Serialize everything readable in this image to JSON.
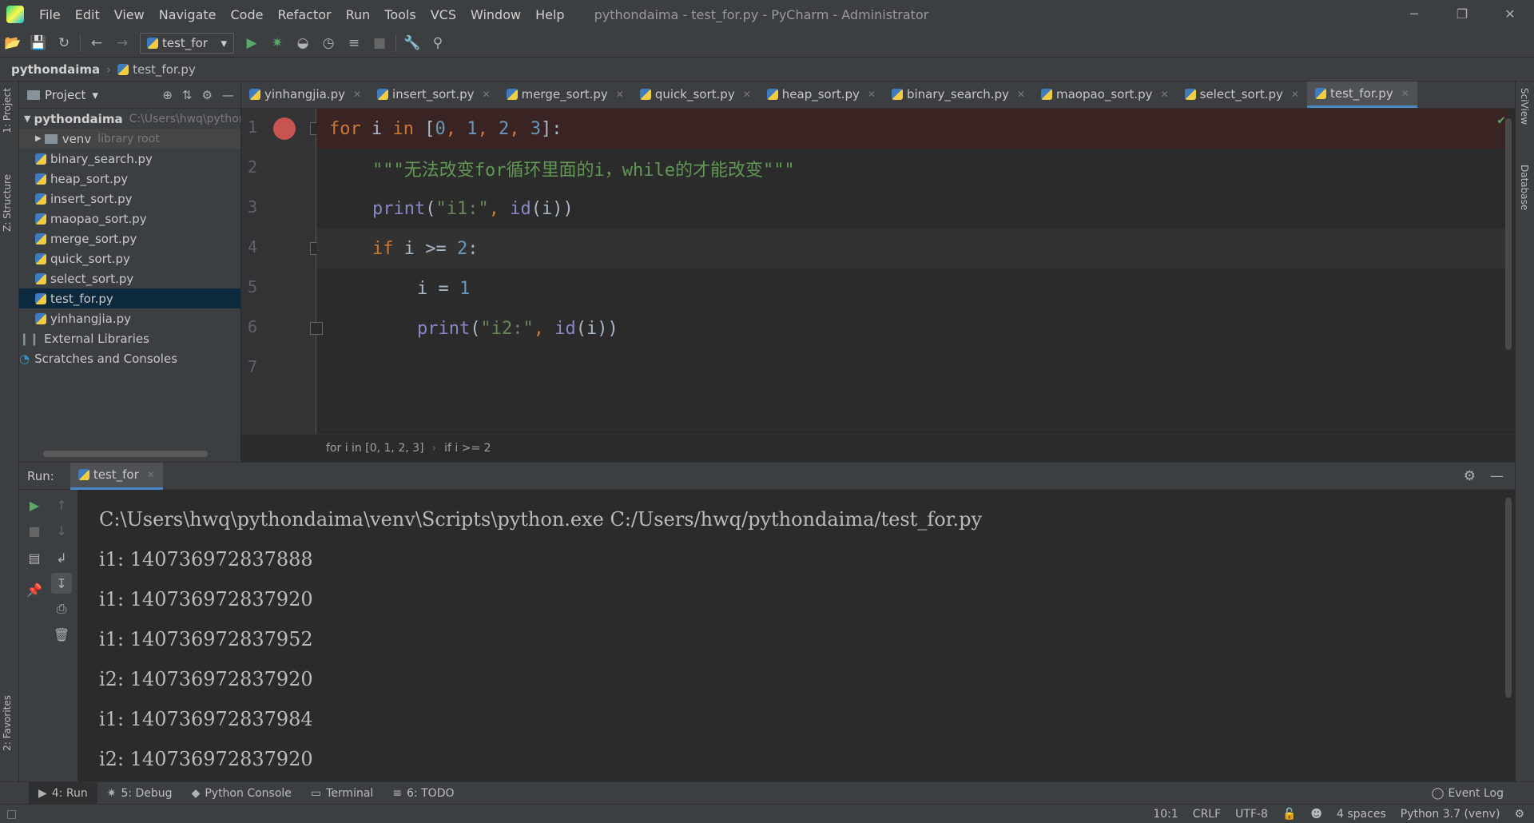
{
  "window": {
    "title": "pythondaima - test_for.py - PyCharm - Administrator",
    "minimize": "─",
    "restore": "❐",
    "close": "✕"
  },
  "menu": [
    "File",
    "Edit",
    "View",
    "Navigate",
    "Code",
    "Refactor",
    "Run",
    "Tools",
    "VCS",
    "Window",
    "Help"
  ],
  "toolbar": {
    "run_config": "test_for"
  },
  "navbar": {
    "project": "pythondaima",
    "file": "test_for.py"
  },
  "side_tabs": {
    "project": "1: Project",
    "structure": "Z: Structure",
    "favorites": "2: Favorites",
    "sciview": "SciView",
    "database": "Database"
  },
  "project_panel": {
    "header": "Project",
    "root": {
      "name": "pythondaima",
      "path": "C:\\Users\\hwq\\pythondaima"
    },
    "venv": {
      "name": "venv",
      "note": "library root"
    },
    "files": [
      "binary_search.py",
      "heap_sort.py",
      "insert_sort.py",
      "maopao_sort.py",
      "merge_sort.py",
      "quick_sort.py",
      "select_sort.py",
      "test_for.py",
      "yinhangjia.py"
    ],
    "selected": "test_for.py",
    "external": "External Libraries",
    "scratches": "Scratches and Consoles"
  },
  "editor_tabs": [
    "yinhangjia.py",
    "insert_sort.py",
    "merge_sort.py",
    "quick_sort.py",
    "heap_sort.py",
    "binary_search.py",
    "maopao_sort.py",
    "select_sort.py",
    "test_for.py"
  ],
  "active_tab": "test_for.py",
  "line_numbers": [
    "1",
    "2",
    "3",
    "4",
    "5",
    "6",
    "7"
  ],
  "code": {
    "l1": {
      "kw1": "for",
      "var": " i ",
      "kw2": "in",
      "open": " [",
      "n0": "0",
      "c1": ", ",
      "n1": "1",
      "c2": ", ",
      "n2": "2",
      "c3": ", ",
      "n3": "3",
      "close": "]:"
    },
    "l2": "\"\"\"无法改变for循环里面的i，while的才能改变\"\"\"",
    "l3": {
      "fn": "print",
      "open": "(",
      "s": "\"i1:\"",
      "comma": ", ",
      "fn2": "id",
      "rest": "(i))"
    },
    "l4": {
      "kw": "if",
      "mid": " i >= ",
      "n": "2",
      "end": ":"
    },
    "l5": {
      "var": "i = ",
      "n": "1"
    },
    "l6": {
      "fn": "print",
      "open": "(",
      "s": "\"i2:\"",
      "comma": ", ",
      "fn2": "id",
      "rest": "(i))"
    }
  },
  "breadcrumbs": [
    "for i in [0, 1, 2, 3]",
    "if i >= 2"
  ],
  "run_panel": {
    "label": "Run:",
    "tab": "test_for",
    "output": [
      "C:\\Users\\hwq\\pythondaima\\venv\\Scripts\\python.exe C:/Users/hwq/pythondaima/test_for.py",
      "i1: 140736972837888",
      "i1: 140736972837920",
      "i1: 140736972837952",
      "i2: 140736972837920",
      "i1: 140736972837984",
      "i2: 140736972837920"
    ]
  },
  "tool_windows": [
    "4: Run",
    "5: Debug",
    "Python Console",
    "Terminal",
    "6: TODO"
  ],
  "event_log": "Event Log",
  "status": {
    "position": "10:1",
    "line_sep": "CRLF",
    "encoding": "UTF-8",
    "indent": "4 spaces",
    "interpreter": "Python 3.7 (venv)"
  },
  "colors": {
    "keyword": "#cc7832",
    "number": "#6897bb",
    "string": "#6a8759",
    "builtin": "#8888c6",
    "breakpoint": "#c75450",
    "selection": "#0d293e"
  }
}
